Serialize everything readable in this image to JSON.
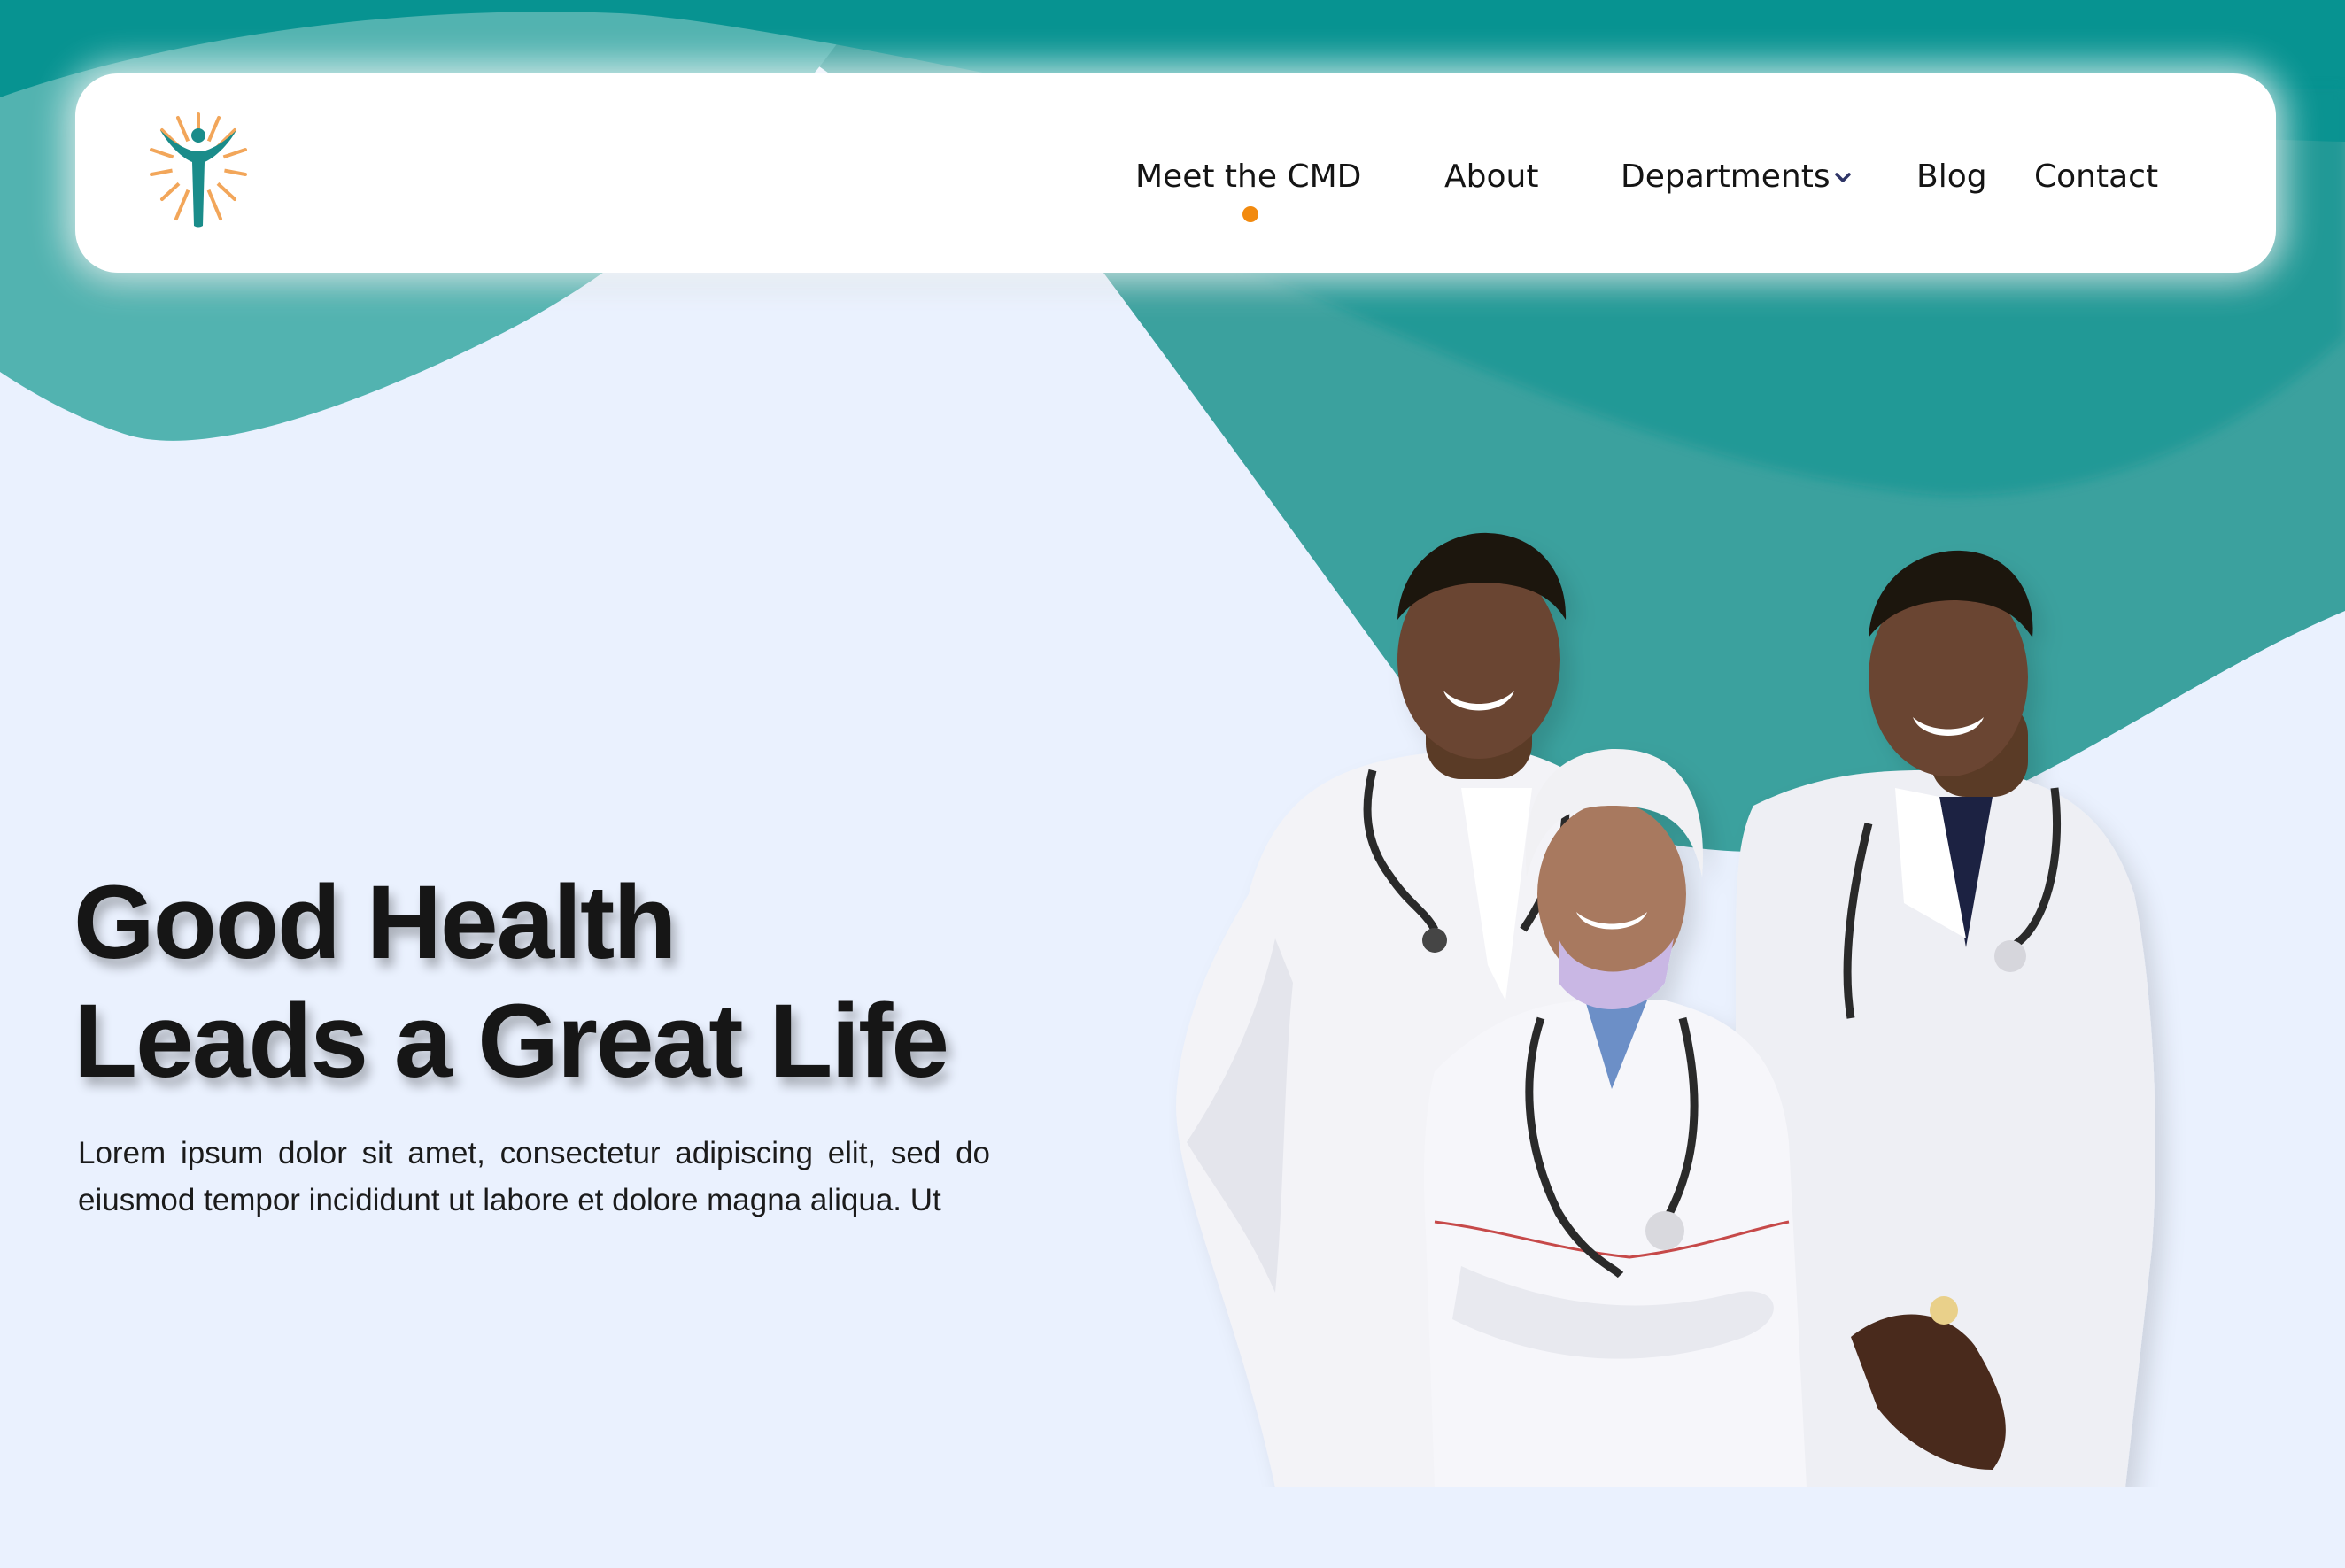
{
  "colors": {
    "teal_dark": "#079391",
    "teal_mid": "#3BA19E",
    "teal_light": "#52B3B0",
    "background": "#EAF1FE",
    "accent_orange": "#F28A0F",
    "text_dark": "#161616",
    "logo_teal": "#1A8C8A",
    "logo_rays": "#F2A65A"
  },
  "header": {
    "logo_icon": "person-sunburst-logo",
    "nav": {
      "meet_cmd": "Meet the CMD",
      "about": "About",
      "departments": "Departments",
      "blog": "Blog",
      "contact": "Contact"
    },
    "active_item": "Meet the CMD",
    "departments_icon": "chevron-down-icon"
  },
  "hero": {
    "title_line1": "Good Health",
    "title_line2": "Leads a Great Life",
    "description": "Lorem ipsum dolor sit amet, consectetur adipiscing elit, sed do eiusmod tempor incididunt ut labore et dolore magna aliqua. Ut",
    "image_subject": "three-doctors-photo"
  }
}
